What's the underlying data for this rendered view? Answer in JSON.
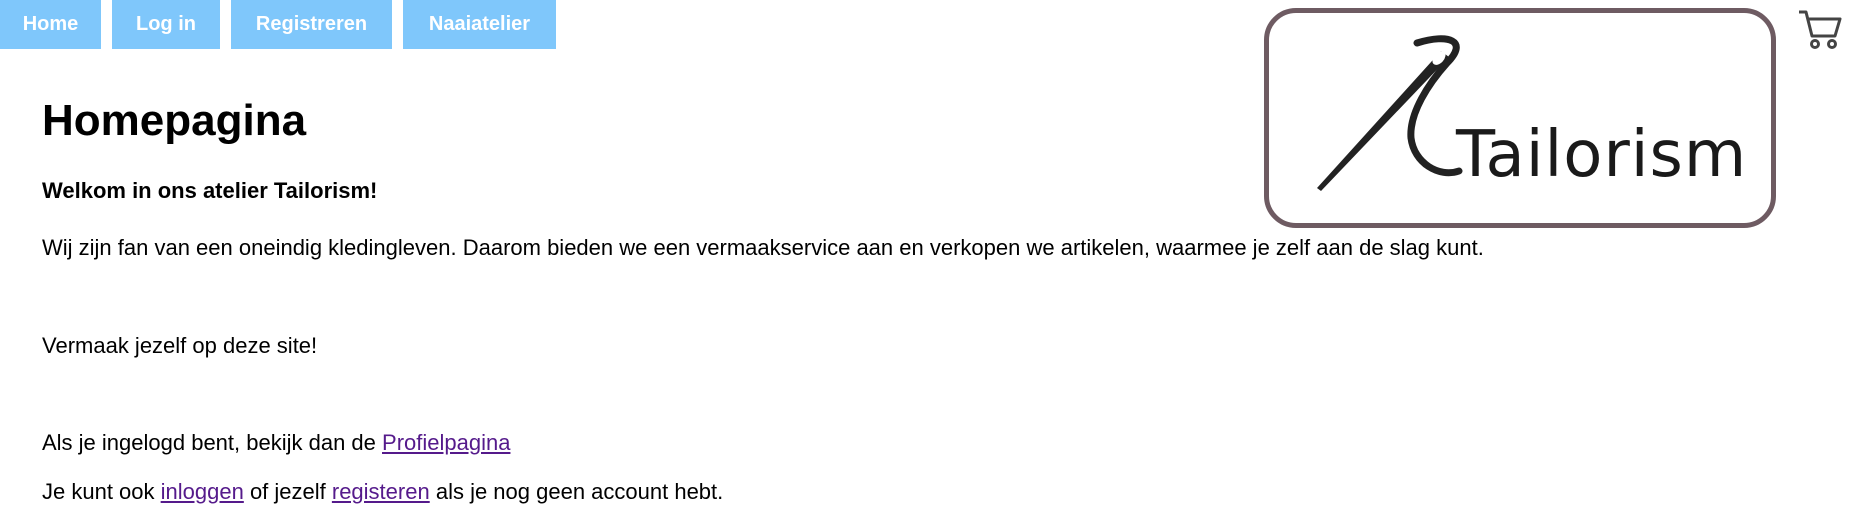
{
  "nav": {
    "items": [
      {
        "label": "Home"
      },
      {
        "label": "Log in"
      },
      {
        "label": "Registreren"
      },
      {
        "label": "Naaiatelier"
      }
    ]
  },
  "logo": {
    "text": "Tailorism",
    "icon": "needle-thread-icon"
  },
  "cart": {
    "icon": "cart-icon"
  },
  "main": {
    "title": "Homepagina",
    "welcome": "Welkom in ons atelier Tailorism!",
    "intro": "Wij zijn fan van een oneindig kledingleven. Daarom bieden we een vermaakservice aan en verkopen we artikelen, waarmee je zelf aan de slag kunt.",
    "fun": "Vermaak jezelf op deze site!",
    "profile_prefix": "Als je ingelogd bent, bekijk dan de ",
    "profile_link": "Profielpagina",
    "account_prefix": "Je kunt ook ",
    "login_link": "inloggen",
    "account_middle": " of jezelf ",
    "register_link": "registeren",
    "account_suffix": " als je nog geen account hebt."
  },
  "colors": {
    "nav_bg": "#7fc7fb",
    "link": "#551a8b",
    "logo_border": "#6e5b62"
  }
}
